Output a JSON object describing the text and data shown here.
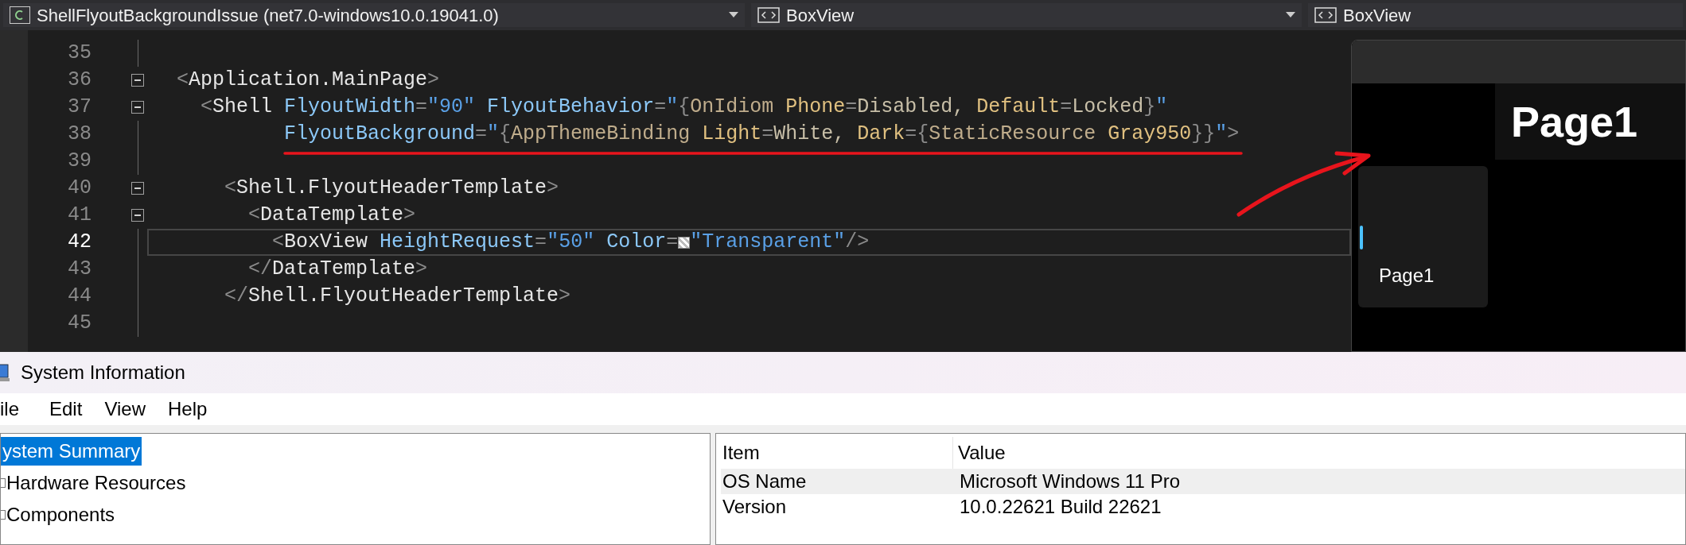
{
  "toolbar": {
    "project_dropdown": "ShellFlyoutBackgroundIssue (net7.0-windows10.0.19041.0)",
    "element_dropdowns": [
      "BoxView",
      "BoxView"
    ]
  },
  "editor": {
    "lines": [
      {
        "number": "35",
        "current": false,
        "collapsible": false
      },
      {
        "number": "36",
        "current": false,
        "collapsible": true,
        "tokens": [
          {
            "text": "<",
            "kind": "punct"
          },
          {
            "text": "Application.MainPage",
            "kind": "tag"
          },
          {
            "text": ">",
            "kind": "punct"
          }
        ]
      },
      {
        "number": "37",
        "current": false,
        "collapsible": true,
        "tokens": [
          {
            "text": "  <",
            "kind": "punct"
          },
          {
            "text": "Shell",
            "kind": "tag"
          },
          {
            "text": " FlyoutWidth",
            "kind": "attr"
          },
          {
            "text": "=",
            "kind": "punct"
          },
          {
            "text": "\"90\"",
            "kind": "str"
          },
          {
            "text": " FlyoutBehavior",
            "kind": "attr"
          },
          {
            "text": "=",
            "kind": "punct"
          },
          {
            "text": "\"",
            "kind": "str"
          },
          {
            "text": "{",
            "kind": "punct"
          },
          {
            "text": "OnIdiom ",
            "kind": "ext"
          },
          {
            "text": "Phone",
            "kind": "prop"
          },
          {
            "text": "=",
            "kind": "punct"
          },
          {
            "text": "Disabled, ",
            "kind": "val"
          },
          {
            "text": "Default",
            "kind": "prop"
          },
          {
            "text": "=",
            "kind": "punct"
          },
          {
            "text": "Locked",
            "kind": "val"
          },
          {
            "text": "}",
            "kind": "punct"
          },
          {
            "text": "\"",
            "kind": "str"
          }
        ]
      },
      {
        "number": "38",
        "current": false,
        "collapsible": false,
        "tokens": [
          {
            "text": "         FlyoutBackground",
            "kind": "attr"
          },
          {
            "text": "=",
            "kind": "punct"
          },
          {
            "text": "\"",
            "kind": "str"
          },
          {
            "text": "{",
            "kind": "punct"
          },
          {
            "text": "AppThemeBinding ",
            "kind": "ext"
          },
          {
            "text": "Light",
            "kind": "prop"
          },
          {
            "text": "=",
            "kind": "punct"
          },
          {
            "text": "White, ",
            "kind": "val"
          },
          {
            "text": "Dark",
            "kind": "prop"
          },
          {
            "text": "={",
            "kind": "punct"
          },
          {
            "text": "StaticResource ",
            "kind": "ext"
          },
          {
            "text": "Gray950",
            "kind": "prop"
          },
          {
            "text": "}}",
            "kind": "punct"
          },
          {
            "text": "\"",
            "kind": "str"
          },
          {
            "text": ">",
            "kind": "punct"
          }
        ]
      },
      {
        "number": "39",
        "current": false,
        "collapsible": false
      },
      {
        "number": "40",
        "current": false,
        "collapsible": true,
        "tokens": [
          {
            "text": "    <",
            "kind": "punct"
          },
          {
            "text": "Shell.FlyoutHeaderTemplate",
            "kind": "tag"
          },
          {
            "text": ">",
            "kind": "punct"
          }
        ]
      },
      {
        "number": "41",
        "current": false,
        "collapsible": true,
        "tokens": [
          {
            "text": "      <",
            "kind": "punct"
          },
          {
            "text": "DataTemplate",
            "kind": "tag"
          },
          {
            "text": ">",
            "kind": "punct"
          }
        ]
      },
      {
        "number": "42",
        "current": true,
        "collapsible": false,
        "tokens": [
          {
            "text": "        <",
            "kind": "punct"
          },
          {
            "text": "BoxView",
            "kind": "tag"
          },
          {
            "text": " HeightRequest",
            "kind": "attr"
          },
          {
            "text": "=",
            "kind": "punct"
          },
          {
            "text": "\"50\"",
            "kind": "str"
          },
          {
            "text": " Color",
            "kind": "attr"
          },
          {
            "text": "=",
            "kind": "punct"
          },
          {
            "kind": "swatch"
          },
          {
            "text": "\"Transparent\"",
            "kind": "str"
          },
          {
            "text": "/>",
            "kind": "punct"
          }
        ]
      },
      {
        "number": "43",
        "current": false,
        "collapsible": false,
        "tokens": [
          {
            "text": "      </",
            "kind": "punct"
          },
          {
            "text": "DataTemplate",
            "kind": "tag"
          },
          {
            "text": ">",
            "kind": "punct"
          }
        ]
      },
      {
        "number": "44",
        "current": false,
        "collapsible": false,
        "tokens": [
          {
            "text": "    </",
            "kind": "punct"
          },
          {
            "text": "Shell.FlyoutHeaderTemplate",
            "kind": "tag"
          },
          {
            "text": ">",
            "kind": "punct"
          }
        ]
      },
      {
        "number": "45",
        "current": false,
        "collapsible": false
      }
    ]
  },
  "preview": {
    "page_title": "Page1",
    "flyout_items": [
      {
        "label": "Page1",
        "selected": true
      }
    ]
  },
  "system_information": {
    "title": "System Information",
    "menu": [
      "ile",
      "Edit",
      "View",
      "Help"
    ],
    "tree": [
      {
        "label": "ystem Summary",
        "selected": true,
        "children": [
          {
            "label": "Hardware Resources",
            "selected": false
          },
          {
            "label": "Components",
            "selected": false
          }
        ]
      }
    ],
    "table": {
      "columns": [
        "Item",
        "Value"
      ],
      "rows": [
        {
          "cells": [
            "OS Name",
            "Microsoft Windows 11 Pro"
          ],
          "selected": true
        },
        {
          "cells": [
            "Version",
            "10.0.22621 Build 22621"
          ],
          "selected": false
        }
      ]
    }
  }
}
